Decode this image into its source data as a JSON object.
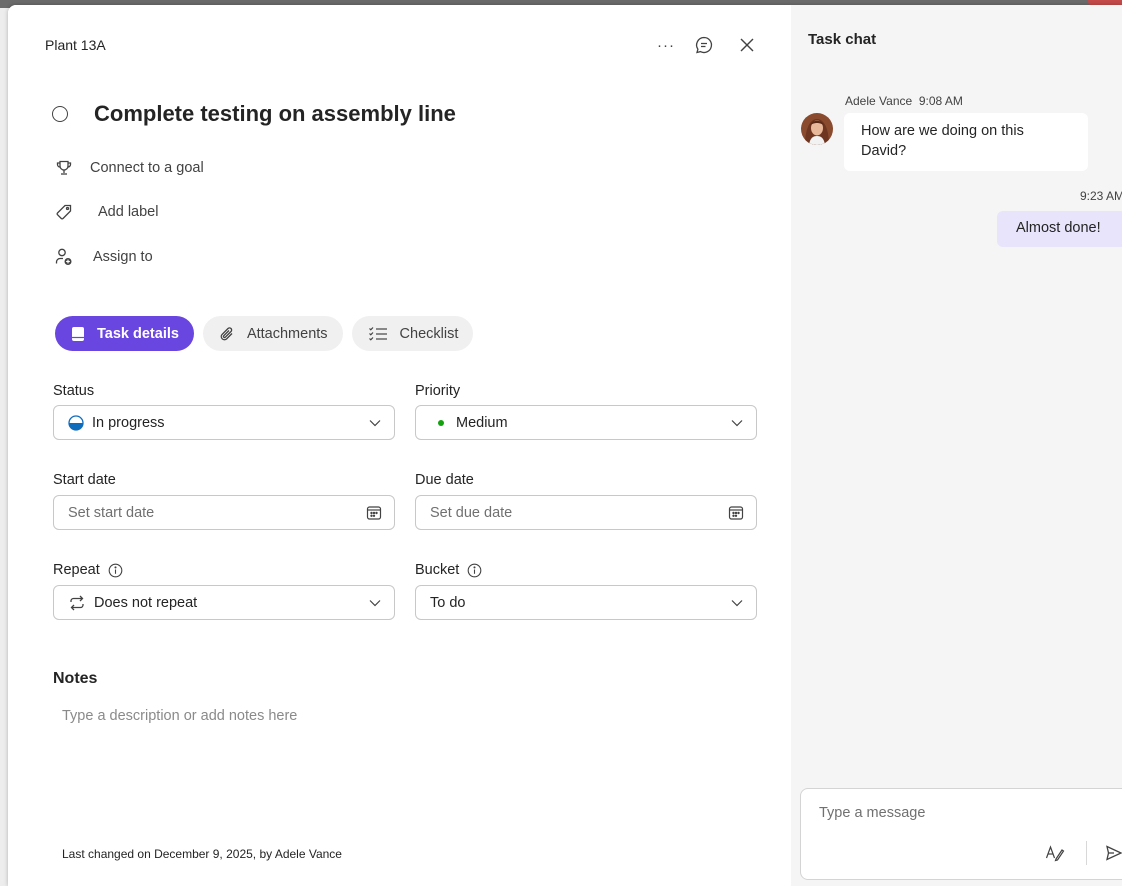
{
  "header": {
    "plan_name": "Plant 13A",
    "more_label": "···",
    "icons": {
      "chat": "chat-icon",
      "close": "close-icon"
    }
  },
  "task": {
    "title": "Complete testing on assembly line",
    "goal_label": "Connect to a goal",
    "label_label": "Add label",
    "assign_label": "Assign to"
  },
  "tabs": [
    {
      "label": "Task details",
      "icon": "notebook-icon",
      "active": true
    },
    {
      "label": "Attachments",
      "icon": "paperclip-icon",
      "active": false
    },
    {
      "label": "Checklist",
      "icon": "checklist-icon",
      "active": false
    }
  ],
  "fields": {
    "status": {
      "label": "Status",
      "value": "In progress"
    },
    "priority": {
      "label": "Priority",
      "value": "Medium",
      "dot_color": "#13a10e"
    },
    "start_date": {
      "label": "Start date",
      "placeholder": "Set start date"
    },
    "due_date": {
      "label": "Due date",
      "placeholder": "Set due date"
    },
    "repeat": {
      "label": "Repeat",
      "value": "Does not repeat"
    },
    "bucket": {
      "label": "Bucket",
      "value": "To do"
    }
  },
  "notes": {
    "title": "Notes",
    "placeholder": "Type a description or add notes here"
  },
  "footer": {
    "last_changed": "Last changed on December 9, 2025, by Adele Vance"
  },
  "chat": {
    "title": "Task chat",
    "messages": [
      {
        "author": "Adele Vance",
        "time": "9:08 AM",
        "text": "How are we doing on this David?",
        "incoming": true
      },
      {
        "author": "",
        "time": "9:23 AM",
        "text": "Almost done!",
        "incoming": false
      }
    ],
    "compose_placeholder": "Type a message"
  },
  "colors": {
    "accent": "#6a46e0",
    "outgoing_bubble": "#e8e4fb",
    "status_blue": "#0f6cbd"
  }
}
